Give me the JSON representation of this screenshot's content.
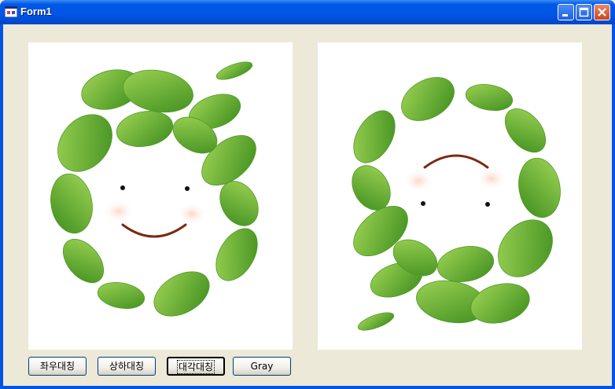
{
  "window": {
    "title": "Form1",
    "icon": "form-app-icon"
  },
  "caption_buttons": [
    "minimize-icon",
    "maximize-icon",
    "close-icon"
  ],
  "buttons": {
    "mirror_lr": "좌우대칭",
    "mirror_ud": "상하대칭",
    "mirror_diag": "대각대칭",
    "gray": "Gray"
  },
  "images": {
    "left": "leaf-wreath-smiley",
    "right": "leaf-wreath-smiley-flipped-vertical"
  },
  "colors": {
    "titlebar": "#0055E5",
    "face": "#ECE9D8",
    "leaf_dark": "#3E8E1E",
    "leaf_light": "#8DCB4A"
  }
}
